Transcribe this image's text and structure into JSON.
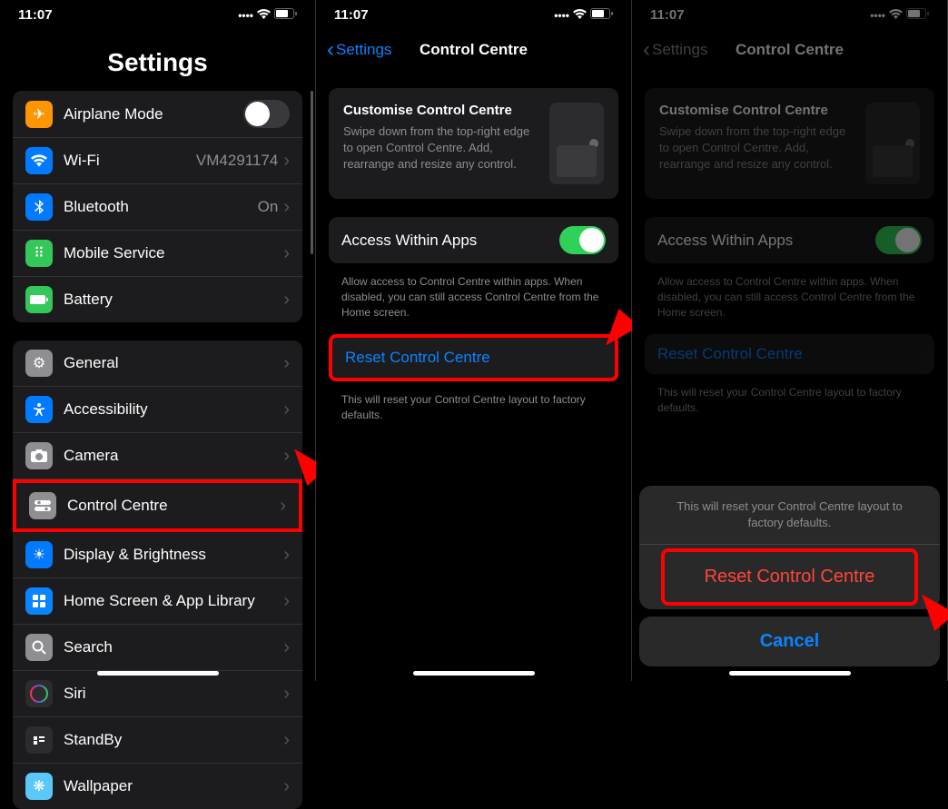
{
  "status": {
    "time": "11:07"
  },
  "screen1": {
    "title": "Settings",
    "rows": {
      "airplane": "Airplane Mode",
      "wifi": "Wi-Fi",
      "wifi_value": "VM4291174",
      "bluetooth": "Bluetooth",
      "bluetooth_value": "On",
      "mobile": "Mobile Service",
      "battery": "Battery",
      "general": "General",
      "accessibility": "Accessibility",
      "camera": "Camera",
      "control_centre": "Control Centre",
      "display": "Display & Brightness",
      "home_screen": "Home Screen & App Library",
      "search": "Search",
      "siri": "Siri",
      "standby": "StandBy",
      "wallpaper": "Wallpaper"
    }
  },
  "screen2": {
    "back": "Settings",
    "title": "Control Centre",
    "card_title": "Customise Control Centre",
    "card_desc": "Swipe down from the top-right edge to open Control Centre. Add, rearrange and resize any control.",
    "access_label": "Access Within Apps",
    "access_desc": "Allow access to Control Centre within apps. When disabled, you can still access Control Centre from the Home screen.",
    "reset_label": "Reset Control Centre",
    "reset_desc": "This will reset your Control Centre layout to factory defaults."
  },
  "screen3": {
    "back": "Settings",
    "title": "Control Centre",
    "sheet_msg": "This will reset your Control Centre layout to factory defaults.",
    "sheet_reset": "Reset Control Centre",
    "sheet_cancel": "Cancel"
  }
}
